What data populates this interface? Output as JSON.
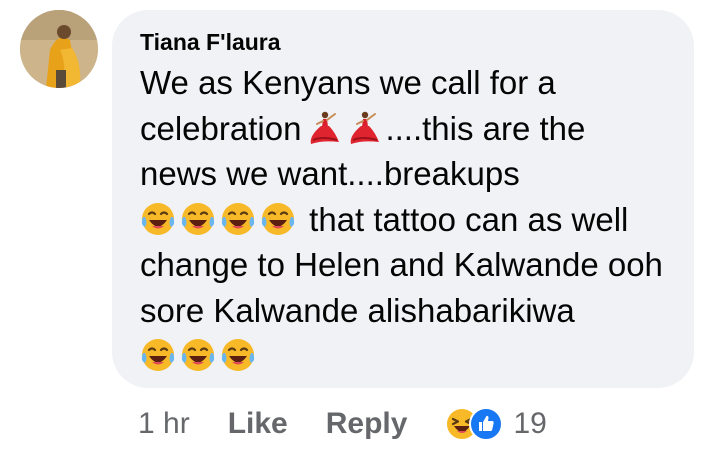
{
  "comment": {
    "author": "Tiana F'laura",
    "lines": [
      {
        "before": "We as Kenyans we call for a",
        "after": ""
      },
      {
        "before": "celebration",
        "after": "....this are the"
      },
      {
        "before": "news we want....breakups",
        "after": ""
      },
      {
        "before": "",
        "after": " that tattoo can as well"
      },
      {
        "before": "change to Helen and Kalwande ooh",
        "after": ""
      },
      {
        "before": "sore Kalwande alishabarikiwa",
        "after": ""
      }
    ],
    "emoji_names": [
      "dancer-emoji",
      "tears-of-joy-emoji"
    ]
  },
  "footer": {
    "timestamp": "1 hr",
    "like_label": "Like",
    "reply_label": "Reply",
    "reaction_count": "19",
    "reaction_icons": [
      "haha-reaction-icon",
      "like-reaction-icon"
    ]
  },
  "colors": {
    "bubble": "#f0f2f5",
    "text": "#050505",
    "muted": "#65676b",
    "like_blue": "#1877f2",
    "haha_yellow": "#f7b928"
  }
}
